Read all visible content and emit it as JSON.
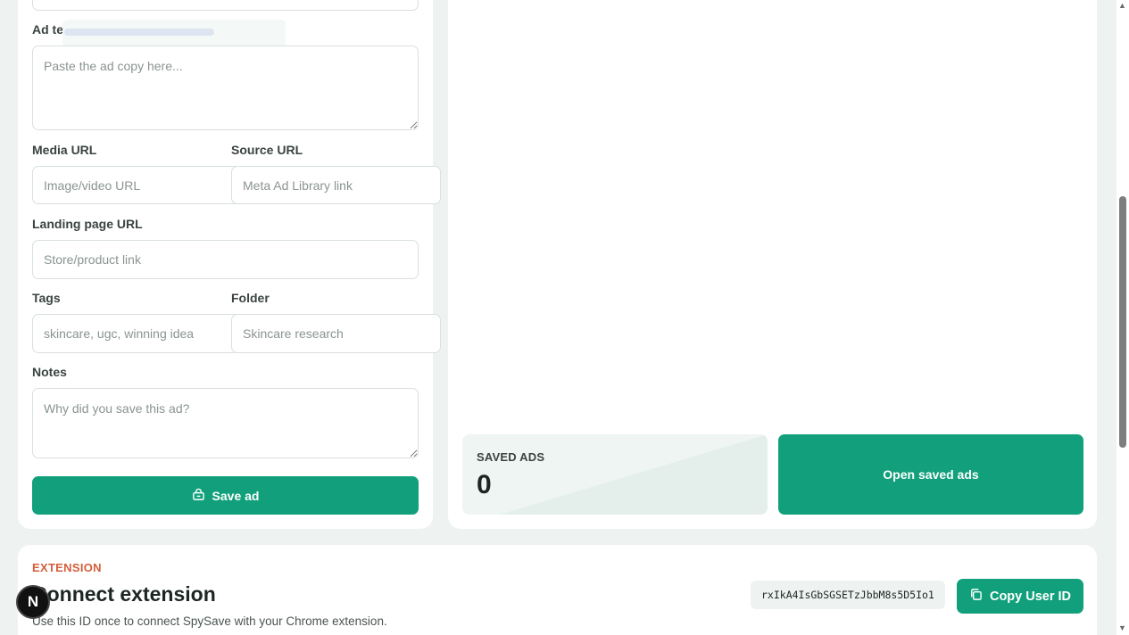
{
  "form": {
    "ad_text_label": "Ad te",
    "ad_text_placeholder": "Paste the ad copy here...",
    "media_url_label": "Media URL",
    "media_url_placeholder": "Image/video URL",
    "source_url_label": "Source URL",
    "source_url_placeholder": "Meta Ad Library link",
    "landing_url_label": "Landing page URL",
    "landing_url_placeholder": "Store/product link",
    "tags_label": "Tags",
    "tags_placeholder": "skincare, ugc, winning idea",
    "folder_label": "Folder",
    "folder_placeholder": "Skincare research",
    "notes_label": "Notes",
    "notes_placeholder": "Why did you save this ad?",
    "save_label": "Save ad"
  },
  "stats": {
    "saved_ads_label": "SAVED ADS",
    "saved_ads_value": "0",
    "open_saved_label": "Open saved ads"
  },
  "extension": {
    "eyebrow": "EXTENSION",
    "title": "Connect extension",
    "description": "Use this ID once to connect SpySave with your Chrome extension.",
    "user_id": "rxIkA4IsGbSGSETzJbbM8s5D5Io1",
    "copy_label": "Copy User ID"
  },
  "badge": {
    "letter": "N"
  },
  "colors": {
    "accent": "#11a07b",
    "eyebrow": "#d45f3c",
    "background": "#eef3f1"
  },
  "icons": {
    "save": "save-icon",
    "copy": "copy-icon"
  }
}
